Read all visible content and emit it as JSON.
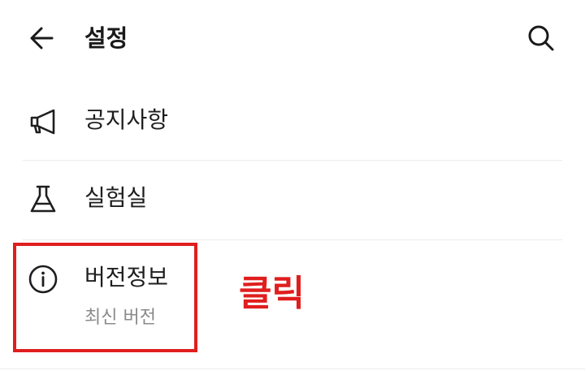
{
  "header": {
    "title": "설정",
    "back_icon": "arrow-left-icon",
    "search_icon": "search-icon"
  },
  "menu": {
    "items": [
      {
        "label": "공지사항",
        "icon": "megaphone-icon"
      },
      {
        "label": "실험실",
        "icon": "flask-icon"
      },
      {
        "label": "버전정보",
        "sublabel": "최신 버전",
        "icon": "info-icon"
      }
    ]
  },
  "annotation": {
    "text": "클릭",
    "color": "#e01e1e"
  }
}
